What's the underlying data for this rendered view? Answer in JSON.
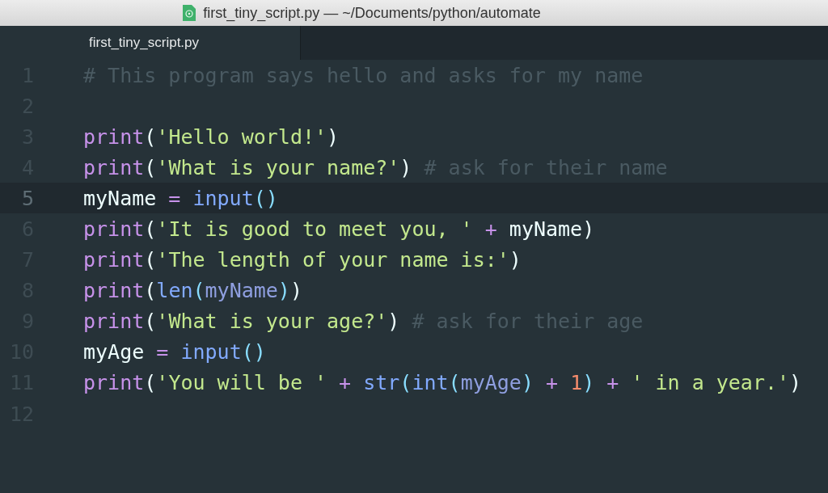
{
  "window": {
    "title": "first_tiny_script.py — ~/Documents/python/automate"
  },
  "tabs": [
    {
      "label": "first_tiny_script.py",
      "selected": true
    }
  ],
  "editor": {
    "lines": [
      {
        "number": "1",
        "active": false,
        "tokens": [
          {
            "text": "# This program says hello and asks for my name",
            "kind": "comment"
          }
        ]
      },
      {
        "number": "2",
        "active": false
      },
      {
        "number": "3",
        "active": false,
        "tokens": [
          {
            "text": "print",
            "kind": "keyword"
          },
          {
            "text": "(",
            "kind": "plain"
          },
          {
            "text": "'Hello world!'",
            "kind": "string"
          },
          {
            "text": ")",
            "kind": "plain"
          }
        ]
      },
      {
        "number": "4",
        "active": false,
        "tokens": [
          {
            "text": "print",
            "kind": "keyword"
          },
          {
            "text": "(",
            "kind": "plain"
          },
          {
            "text": "'What is your name?'",
            "kind": "string"
          },
          {
            "text": ")",
            "kind": "plain"
          },
          {
            "text": " # ask for their name",
            "kind": "comment"
          }
        ]
      },
      {
        "number": "5",
        "active": true,
        "tokens": [
          {
            "text": "myName",
            "kind": "plain"
          },
          {
            "text": " = ",
            "kind": "operator"
          },
          {
            "text": "input",
            "kind": "builtin"
          },
          {
            "text": "()",
            "kind": "bracket"
          }
        ]
      },
      {
        "number": "6",
        "active": false,
        "tokens": [
          {
            "text": "print",
            "kind": "keyword"
          },
          {
            "text": "(",
            "kind": "plain"
          },
          {
            "text": "'It is good to meet you, '",
            "kind": "string"
          },
          {
            "text": " + ",
            "kind": "operator"
          },
          {
            "text": "myName",
            "kind": "plain"
          },
          {
            "text": ")",
            "kind": "plain"
          }
        ]
      },
      {
        "number": "7",
        "active": false,
        "tokens": [
          {
            "text": "print",
            "kind": "keyword"
          },
          {
            "text": "(",
            "kind": "plain"
          },
          {
            "text": "'The length of your name is:'",
            "kind": "string"
          },
          {
            "text": ")",
            "kind": "plain"
          }
        ]
      },
      {
        "number": "8",
        "active": false,
        "tokens": [
          {
            "text": "print",
            "kind": "keyword"
          },
          {
            "text": "(",
            "kind": "plain"
          },
          {
            "text": "len",
            "kind": "builtin"
          },
          {
            "text": "(",
            "kind": "bracket"
          },
          {
            "text": "myName",
            "kind": "variable"
          },
          {
            "text": ")",
            "kind": "bracket"
          },
          {
            "text": ")",
            "kind": "plain"
          }
        ]
      },
      {
        "number": "9",
        "active": false,
        "tokens": [
          {
            "text": "print",
            "kind": "keyword"
          },
          {
            "text": "(",
            "kind": "plain"
          },
          {
            "text": "'What is your age?'",
            "kind": "string"
          },
          {
            "text": ")",
            "kind": "plain"
          },
          {
            "text": " # ask for their age",
            "kind": "comment"
          }
        ]
      },
      {
        "number": "10",
        "active": false,
        "tokens": [
          {
            "text": "myAge",
            "kind": "plain"
          },
          {
            "text": " = ",
            "kind": "operator"
          },
          {
            "text": "input",
            "kind": "builtin"
          },
          {
            "text": "()",
            "kind": "bracket"
          }
        ]
      },
      {
        "number": "11",
        "active": false,
        "tokens": [
          {
            "text": "print",
            "kind": "keyword"
          },
          {
            "text": "(",
            "kind": "plain"
          },
          {
            "text": "'You will be '",
            "kind": "string"
          },
          {
            "text": " + ",
            "kind": "operator"
          },
          {
            "text": "str",
            "kind": "builtin"
          },
          {
            "text": "(",
            "kind": "bracket"
          },
          {
            "text": "int",
            "kind": "builtin"
          },
          {
            "text": "(",
            "kind": "bracket"
          },
          {
            "text": "myAge",
            "kind": "variable"
          },
          {
            "text": ")",
            "kind": "bracket"
          },
          {
            "text": " + ",
            "kind": "operator"
          },
          {
            "text": "1",
            "kind": "number"
          },
          {
            "text": ")",
            "kind": "bracket"
          },
          {
            "text": " + ",
            "kind": "operator"
          },
          {
            "text": "' in a year.'",
            "kind": "string"
          },
          {
            "text": ")",
            "kind": "plain"
          }
        ]
      },
      {
        "number": "12",
        "active": false
      }
    ]
  }
}
